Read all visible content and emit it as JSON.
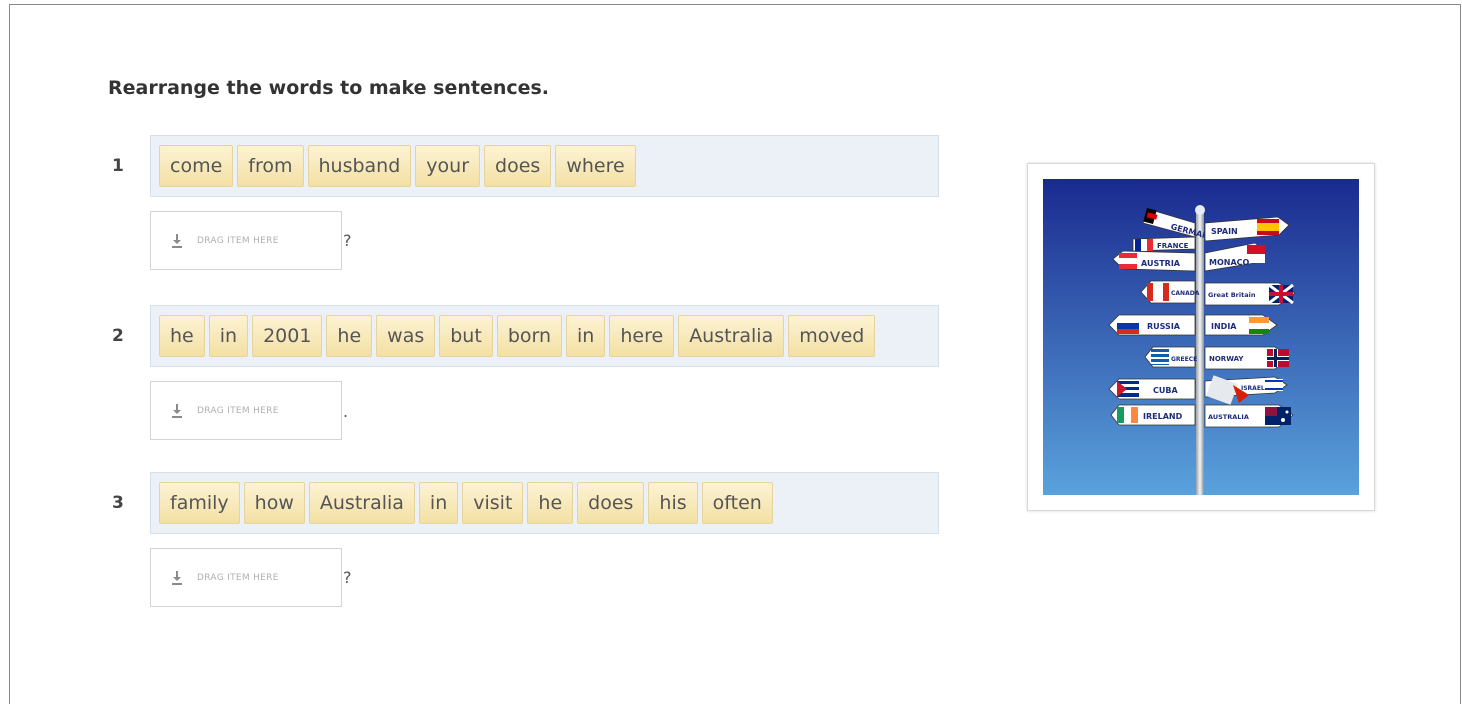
{
  "instruction": "Rearrange the words to make sentences.",
  "questions": [
    {
      "number": "1",
      "words": [
        "come",
        "from",
        "husband",
        "your",
        "does",
        "where"
      ],
      "drop_label": "DRAG ITEM HERE",
      "punctuation": "?"
    },
    {
      "number": "2",
      "words": [
        "he",
        "in",
        "2001",
        "he",
        "was",
        "but",
        "born",
        "in",
        "here",
        "Australia",
        "moved"
      ],
      "drop_label": "DRAG ITEM HERE",
      "punctuation": "."
    },
    {
      "number": "3",
      "words": [
        "family",
        "how",
        "Australia",
        "in",
        "visit",
        "he",
        "does",
        "his",
        "often"
      ],
      "drop_label": "DRAG ITEM HERE",
      "punctuation": "?"
    }
  ],
  "signpost": {
    "signs": [
      "GERMANY",
      "SPAIN",
      "FRANCE",
      "AUSTRIA",
      "MONACO",
      "CANADA",
      "Great Britain",
      "RUSSIA",
      "INDIA",
      "GREECE",
      "NORWAY",
      "CUBA",
      "ISRAEL",
      "IRELAND",
      "AUSTRALIA"
    ]
  },
  "colors": {
    "word_tile": "#f6e6b0",
    "word_bank": "#ebf1f6",
    "sky_top": "#1a2a8f",
    "sky_bottom": "#5aa2dc"
  }
}
